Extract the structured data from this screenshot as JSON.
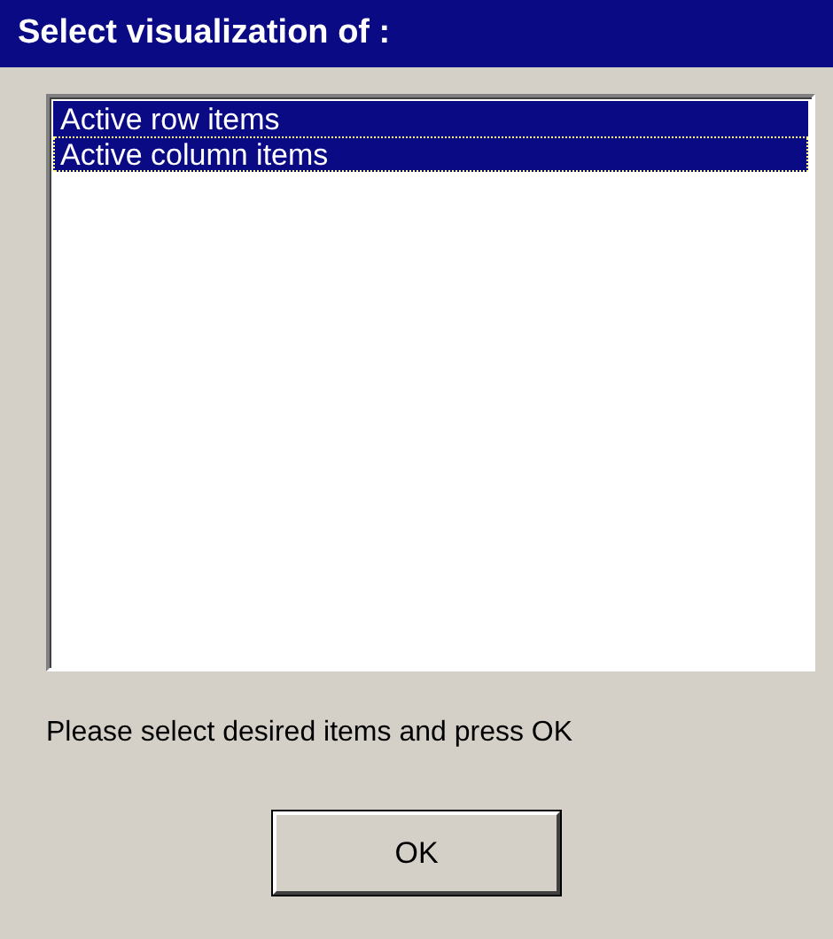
{
  "window": {
    "title": "Select visualization of :"
  },
  "list": {
    "items": [
      {
        "label": "Active row items",
        "selected": true,
        "focused": false
      },
      {
        "label": "Active column items",
        "selected": true,
        "focused": true
      }
    ]
  },
  "hint": "Please select desired items and press OK",
  "buttons": [
    {
      "label": "OK"
    }
  ]
}
